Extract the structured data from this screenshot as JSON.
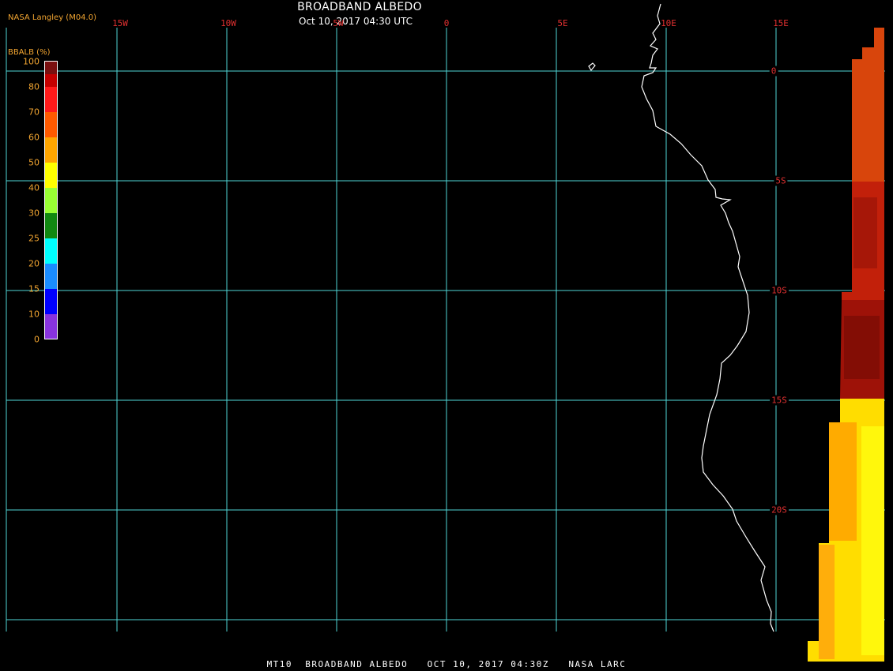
{
  "header": {
    "credit": "NASA Langley (M04.0)",
    "title": "BROADBAND ALBEDO",
    "subtitle": "Oct 10, 2017 04:30 UTC"
  },
  "footer": {
    "caption": "MT10  BROADBAND ALBEDO   OCT 10, 2017 04:30Z   NASA LARC"
  },
  "map": {
    "longitude_labels": [
      "15W",
      "10W",
      "5W",
      "0",
      "5E",
      "10E",
      "15E"
    ],
    "latitude_labels": [
      "0",
      "5S",
      "10S",
      "15S",
      "20S"
    ],
    "grid_color": "#4fd6d6",
    "label_color": "#e03030",
    "coastline_color": "#ffffff"
  },
  "colorbar": {
    "title": "BBALB (%)",
    "ticks": [
      "100",
      "80",
      "70",
      "60",
      "50",
      "40",
      "30",
      "25",
      "20",
      "15",
      "10",
      "0"
    ],
    "colors": [
      "#7a1010",
      "#c40000",
      "#ff1a1a",
      "#ff5a00",
      "#ffa500",
      "#ffff00",
      "#99ff33",
      "#118811",
      "#00ffff",
      "#1a8cff",
      "#0000ff",
      "#8833dd"
    ]
  }
}
